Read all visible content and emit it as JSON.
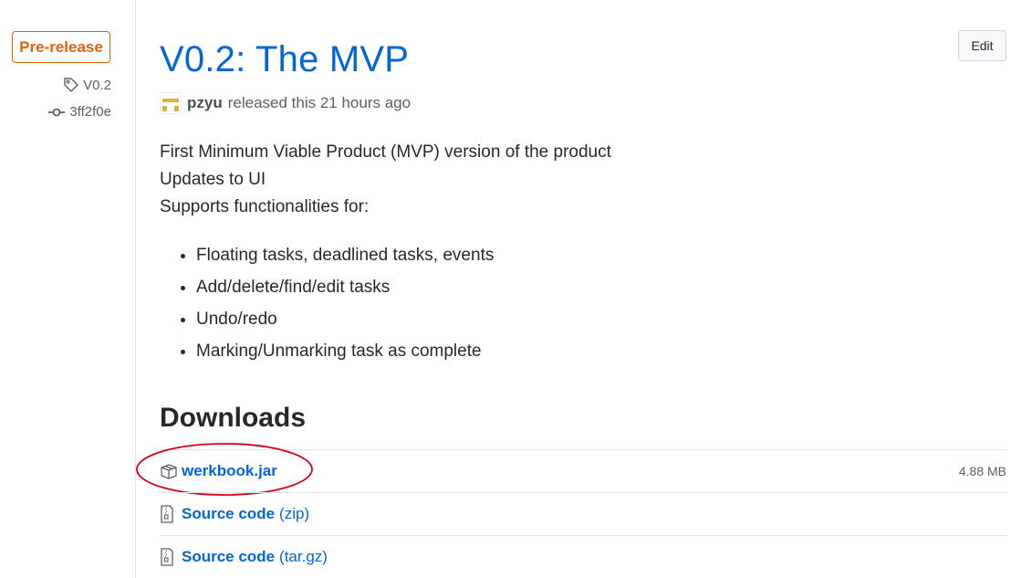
{
  "meta": {
    "badge": "Pre-release",
    "tag": "V0.2",
    "commit": "3ff2f0e",
    "tag_icon": "tag-icon",
    "commit_icon": "git-commit-icon"
  },
  "release": {
    "title": "V0.2: The MVP",
    "edit_label": "Edit",
    "author": "pzyu",
    "released_text": "released this 21 hours ago",
    "description": [
      "First Minimum Viable Product (MVP) version of the product",
      "Updates to UI",
      "Supports functionalities for:"
    ],
    "features": [
      "Floating tasks, deadlined tasks, events",
      "Add/delete/find/edit tasks",
      "Undo/redo",
      "Marking/Unmarking task as complete"
    ]
  },
  "downloads": {
    "heading": "Downloads",
    "items": [
      {
        "name": "werkbook.jar",
        "ext": "",
        "size": "4.88 MB",
        "icon": "package-icon"
      },
      {
        "name": "Source code",
        "ext": "(zip)",
        "size": "",
        "icon": "file-zip-icon"
      },
      {
        "name": "Source code",
        "ext": "(tar.gz)",
        "size": "",
        "icon": "file-zip-icon"
      }
    ]
  },
  "colors": {
    "link": "#0366d6",
    "prerelease": "#e36209",
    "annotation": "#d0021b"
  }
}
